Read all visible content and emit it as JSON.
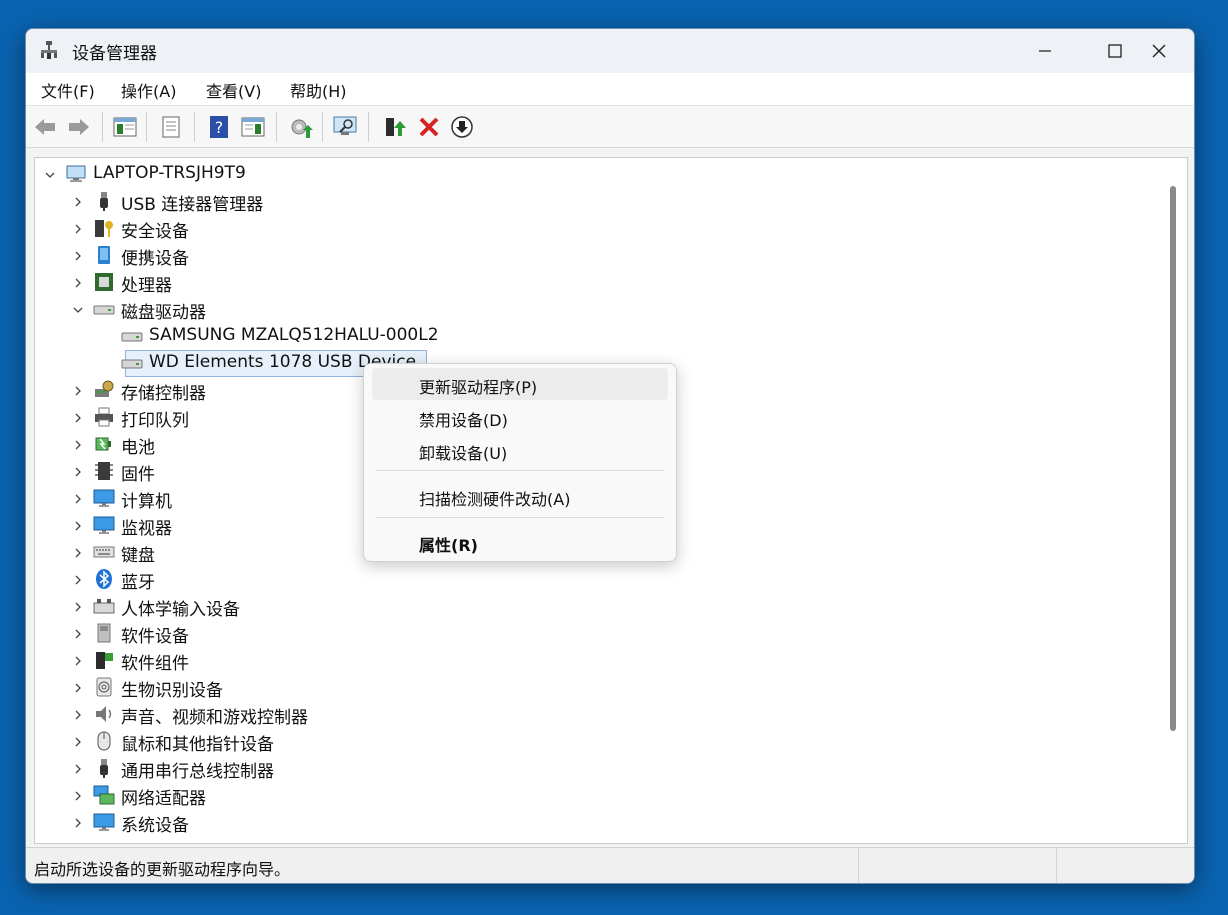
{
  "window": {
    "title": "设备管理器"
  },
  "menu": [
    "文件(F)",
    "操作(A)",
    "查看(V)",
    "帮助(H)"
  ],
  "tree": {
    "root": "LAPTOP-TRSJH9T9",
    "categories": [
      "USB 连接器管理器",
      "安全设备",
      "便携设备",
      "处理器",
      "磁盘驱动器",
      "SAMSUNG MZALQ512HALU-000L2",
      "WD Elements 1078 USB Device",
      "存储控制器",
      "打印队列",
      "电池",
      "固件",
      "计算机",
      "监视器",
      "键盘",
      "蓝牙",
      "人体学输入设备",
      "软件设备",
      "软件组件",
      "生物识别设备",
      "声音、视频和游戏控制器",
      "鼠标和其他指针设备",
      "通用串行总线控制器",
      "网络适配器",
      "系统设备"
    ]
  },
  "context_menu": {
    "update_driver": "更新驱动程序(P)",
    "disable_device": "禁用设备(D)",
    "uninstall_device": "卸载设备(U)",
    "scan_hardware": "扫描检测硬件改动(A)",
    "properties": "属性(R)"
  },
  "status": {
    "text": "启动所选设备的更新驱动程序向导。"
  }
}
